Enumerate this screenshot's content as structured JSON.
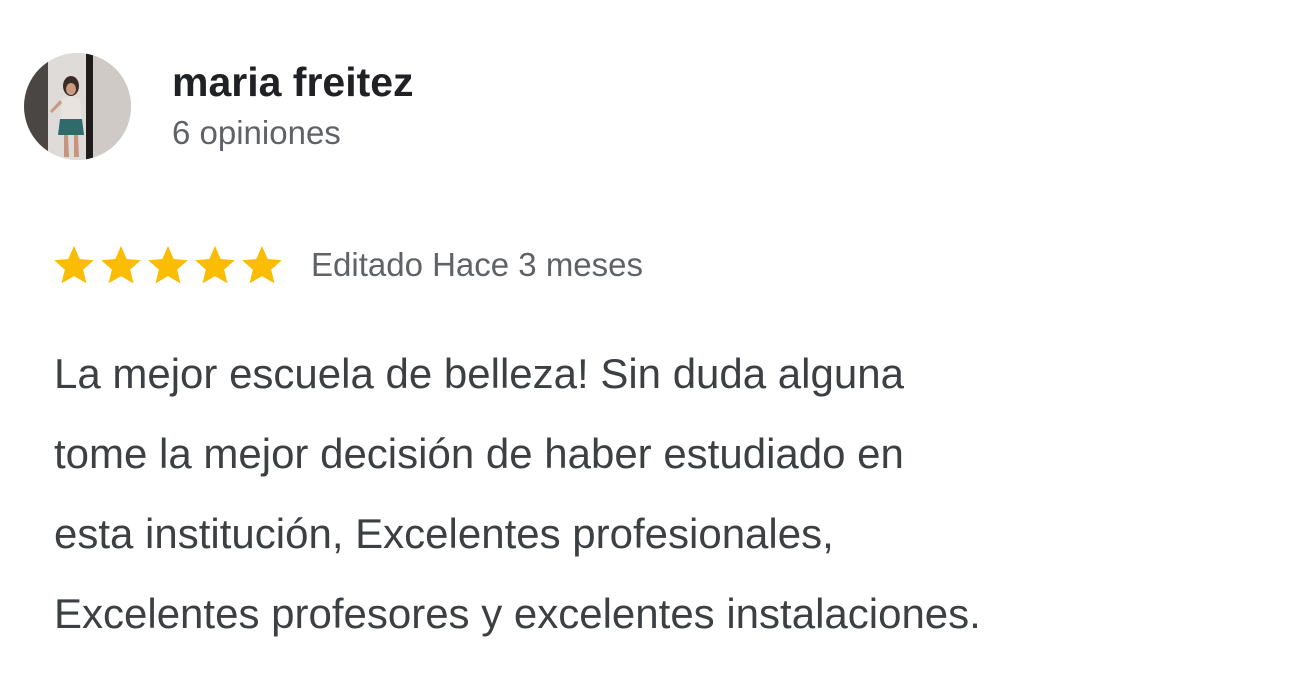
{
  "review": {
    "author": {
      "name": "maria freitez",
      "meta": "6 opiniones",
      "avatar_icon": "user-photo-avatar"
    },
    "rating": {
      "stars": 5,
      "max": 5,
      "star_color": "#fbbc04",
      "star_icon": "star-icon"
    },
    "date": "Editado Hace 3 meses",
    "text_lines": [
      "La mejor escuela de belleza! Sin duda alguna",
      "tome la mejor decisión de haber estudiado en",
      "esta institución, Excelentes profesionales,",
      "Excelentes profesores y excelentes instalaciones."
    ]
  }
}
